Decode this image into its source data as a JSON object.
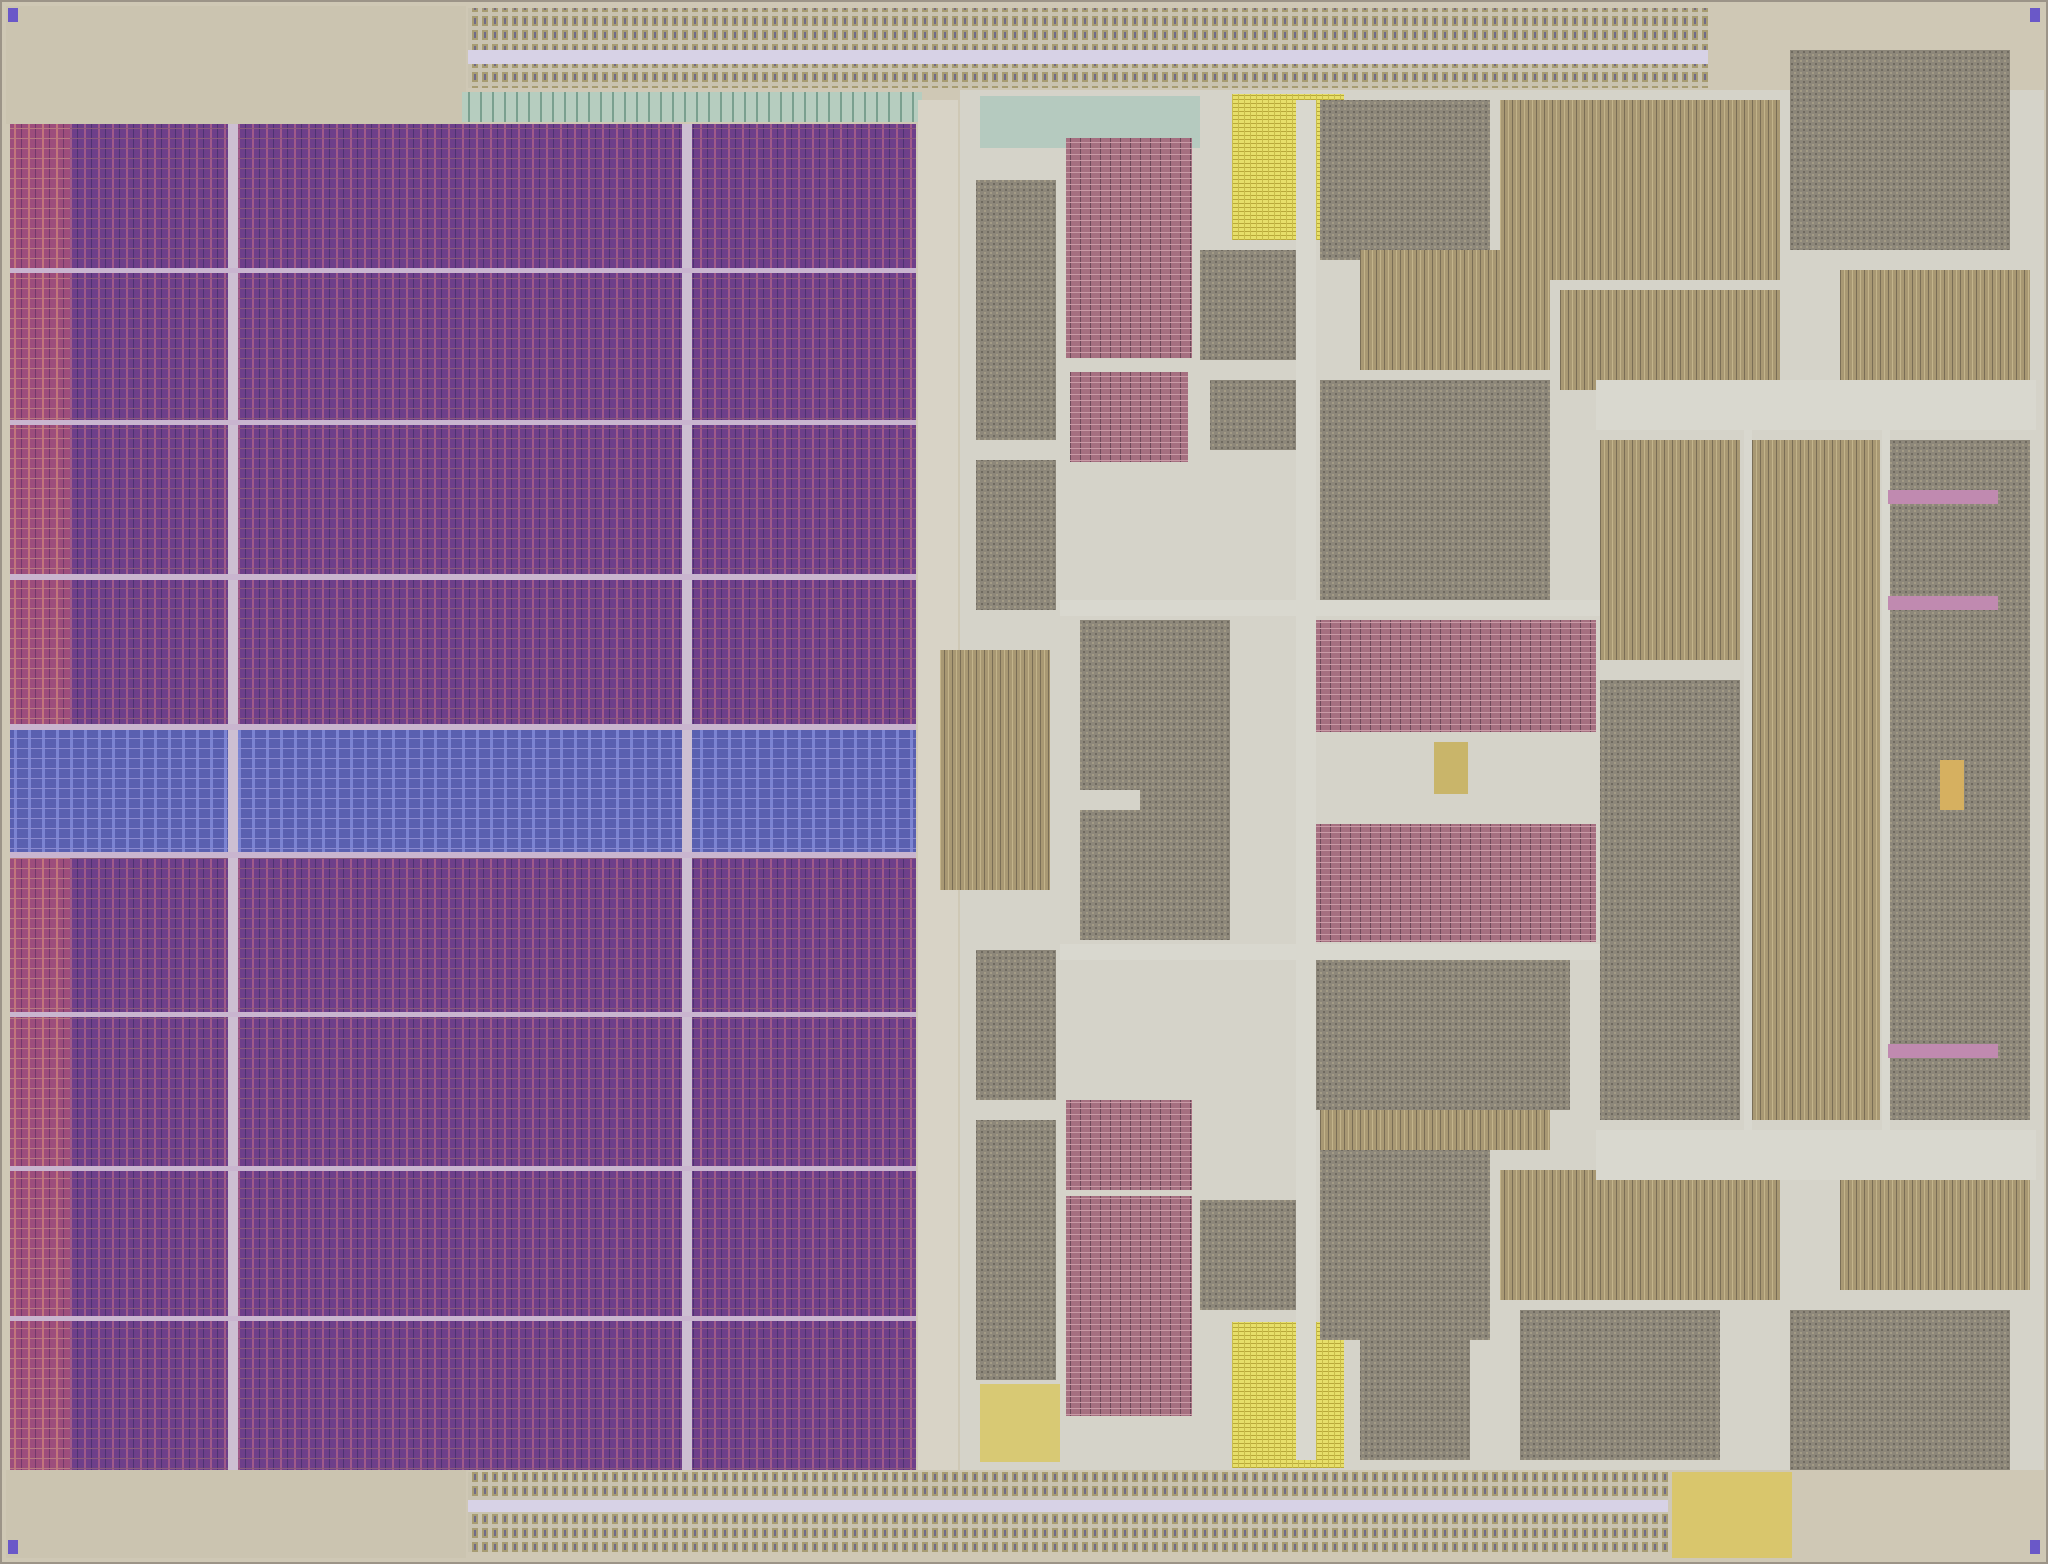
{
  "image": {
    "subject": "die-shot",
    "colors": {
      "die_edge": "#c9c1ac",
      "border_strip": "#cfc8b5",
      "cache_magenta": "#7a3f86",
      "cache_violet": "#5e3f8f",
      "cache_pink": "#b85a7a",
      "cache_blue_band": "#5c63b8",
      "cache_gap": "#c8bfc8",
      "logic_gray": "#8e877a",
      "logic_tan": "#a89a78",
      "logic_olive": "#8a8460",
      "routing_light": "#d8d6cc",
      "routing_mint": "#b7ccc0",
      "array_pink": "#b27a8a",
      "array_rose": "#9a5a6a",
      "yellow_block": "#e7df6a",
      "gold_block": "#c9b56a",
      "corner_mark": "#6a58c8",
      "pad_teal": "#9fc7b3"
    }
  }
}
